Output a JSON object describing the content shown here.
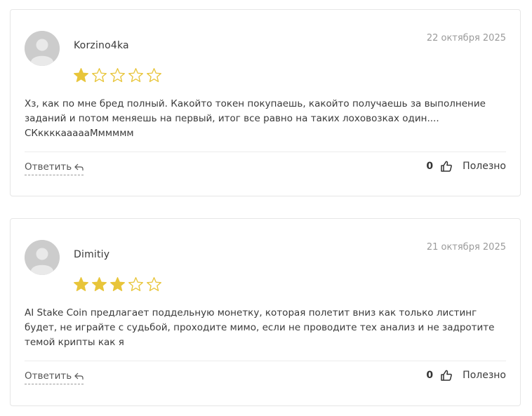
{
  "colors": {
    "star_filled": "#e8c53a",
    "star_empty_stroke": "#e8c53a",
    "border": "#e6e6e6",
    "date": "#9a9a9a"
  },
  "reviews": [
    {
      "author": "Korzino4ka",
      "date": "22 октября 2025",
      "rating": 1,
      "max_rating": 5,
      "text": "Хз, как по мне бред полный. Какойто токен покупаешь, какойто получаешь за выполнение заданий и потом меняешь на первый, итог все равно на таких лоховозках один.... СКккккаааааМммммм",
      "reply_label": "Ответить",
      "reply_icon": "reply-arrow-icon",
      "likes": "0",
      "useful_label": "Полезно",
      "useful_icon": "thumbs-up-icon",
      "avatar_icon": "default-user-avatar-icon"
    },
    {
      "author": "Dimitiy",
      "date": "21 октября 2025",
      "rating": 3,
      "max_rating": 5,
      "text": "AI Stake Coin предлагает поддельную монетку, которая полетит вниз как только листинг будет, не играйте с судьбой, проходите мимо, если не проводите тех анализ и не задротите темой крипты как я",
      "reply_label": "Ответить",
      "reply_icon": "reply-arrow-icon",
      "likes": "0",
      "useful_label": "Полезно",
      "useful_icon": "thumbs-up-icon",
      "avatar_icon": "default-user-avatar-icon"
    }
  ]
}
